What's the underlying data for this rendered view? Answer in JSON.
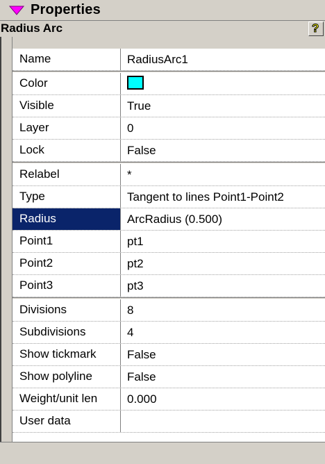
{
  "header": {
    "title": "Properties",
    "icon": "triangle-down-icon",
    "icon_color": "#ff00ff"
  },
  "object": {
    "title": "Radius Arc",
    "help_icon": "help-icon"
  },
  "groups": [
    [
      {
        "name": "Name",
        "value": "RadiusArc1"
      }
    ],
    [
      {
        "name": "Color",
        "value": "",
        "swatch": "#00ffff"
      },
      {
        "name": "Visible",
        "value": "True"
      },
      {
        "name": "Layer",
        "value": "0"
      },
      {
        "name": "Lock",
        "value": "False"
      }
    ],
    [
      {
        "name": "Relabel",
        "value": "*"
      },
      {
        "name": "Type",
        "value": "Tangent to lines Point1-Point2"
      },
      {
        "name": "Radius",
        "value": "ArcRadius (0.500)",
        "selected": true
      },
      {
        "name": "Point1",
        "value": "pt1"
      },
      {
        "name": "Point2",
        "value": "pt2"
      },
      {
        "name": "Point3",
        "value": "pt3"
      }
    ],
    [
      {
        "name": "Divisions",
        "value": "8"
      },
      {
        "name": "Subdivisions",
        "value": "4"
      },
      {
        "name": "Show tickmark",
        "value": "False"
      },
      {
        "name": "Show polyline",
        "value": "False"
      },
      {
        "name": "Weight/unit len",
        "value": "0.000"
      },
      {
        "name": "User data",
        "value": ""
      }
    ]
  ],
  "colors": {
    "selection": "#0a246a",
    "swatch": "#00ffff",
    "chrome": "#d4d0c8"
  }
}
